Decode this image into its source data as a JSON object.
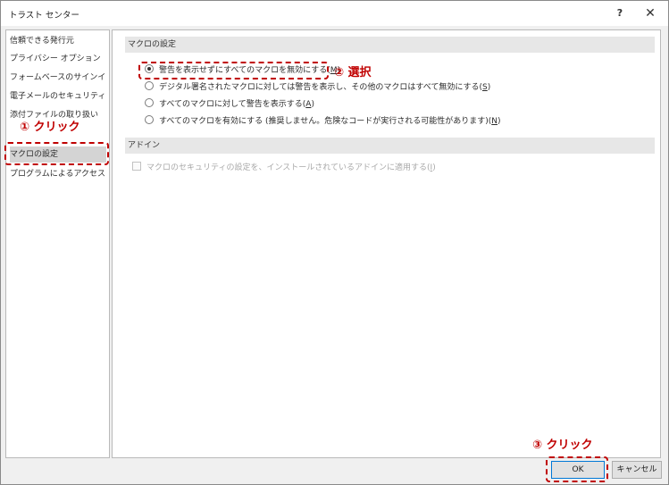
{
  "window": {
    "title": "トラスト センター",
    "help": "?",
    "close": "✕"
  },
  "sidebar": {
    "items": [
      {
        "label": "信頼できる発行元"
      },
      {
        "label": "プライバシー オプション"
      },
      {
        "label": "フォームベースのサインイン"
      },
      {
        "label": "電子メールのセキュリティ"
      },
      {
        "label": "添付ファイルの取り扱い"
      },
      {
        "label": "マクロの設定",
        "selected": true
      },
      {
        "label": "プログラムによるアクセス"
      }
    ]
  },
  "macro_section": {
    "header": "マクロの設定",
    "options": [
      {
        "text": "警告を表示せずにすべてのマクロを無効にする(",
        "key": "M",
        "checked": true
      },
      {
        "text": "デジタル署名されたマクロに対しては警告を表示し、その他のマクロはすべて無効にする(",
        "key": "S",
        "checked": false
      },
      {
        "text": "すべてのマクロに対して警告を表示する(",
        "key": "A",
        "checked": false
      },
      {
        "text": "すべてのマクロを有効にする (推奨しません。危険なコードが実行される可能性があります)(",
        "key": "N",
        "checked": false
      }
    ]
  },
  "addin_section": {
    "header": "アドイン",
    "checkbox": {
      "text": "マクロのセキュリティの設定を、インストールされているアドインに適用する(",
      "key": "I",
      "checked": false,
      "disabled": true
    }
  },
  "annotations": {
    "step1": "① クリック",
    "step2": "② 選択",
    "step3": "③ クリック",
    "color": "#c00000"
  },
  "buttons": {
    "ok": "OK",
    "cancel": "キャンセル"
  }
}
